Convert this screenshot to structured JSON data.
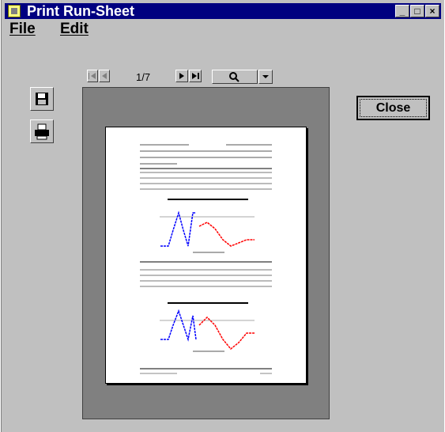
{
  "window": {
    "title": "Print Run-Sheet"
  },
  "menu": {
    "file": "File",
    "edit": "Edit"
  },
  "pager": {
    "current": "1/7"
  },
  "buttons": {
    "close": "Close"
  },
  "icons": {
    "window": "runsheet-app-icon",
    "save": "floppy-disk-icon",
    "print": "printer-icon",
    "first": "first-page-icon",
    "prev": "previous-page-icon",
    "next": "next-page-icon",
    "last": "last-page-icon",
    "zoom": "magnifier-icon",
    "zoom_dropdown": "chevron-down-icon"
  },
  "colors": {
    "titlebar": "#000080",
    "preview_bg": "#808080",
    "trace_blue": "#0000ff",
    "trace_red": "#ff0000"
  }
}
